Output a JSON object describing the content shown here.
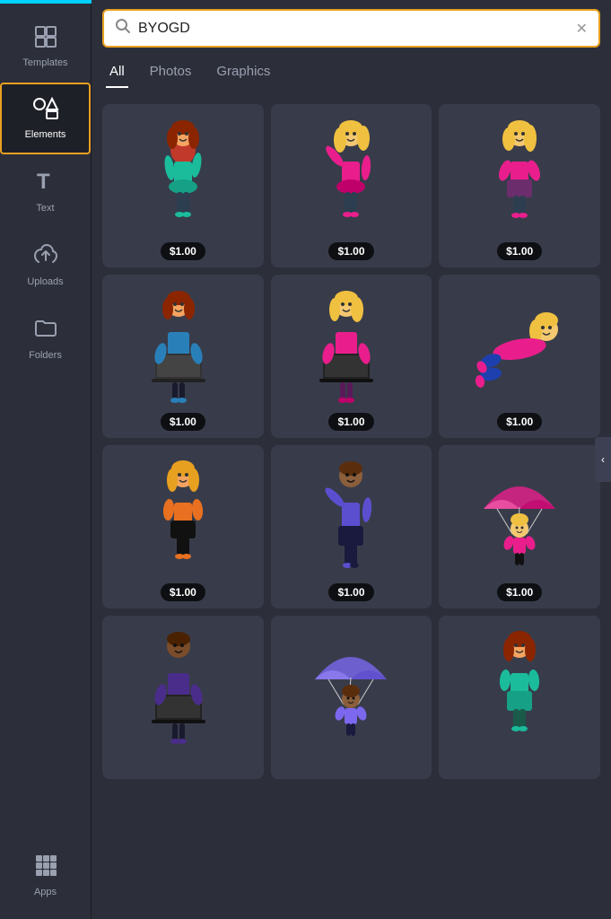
{
  "sidebar": {
    "items": [
      {
        "id": "templates",
        "label": "Templates",
        "icon": "⊞",
        "active": false
      },
      {
        "id": "elements",
        "label": "Elements",
        "icon": "◯△□",
        "active": true
      },
      {
        "id": "text",
        "label": "Text",
        "icon": "T",
        "active": false
      },
      {
        "id": "uploads",
        "label": "Uploads",
        "icon": "↑",
        "active": false
      },
      {
        "id": "folders",
        "label": "Folders",
        "icon": "🗂",
        "active": false
      },
      {
        "id": "apps",
        "label": "Apps",
        "icon": "⋯",
        "active": false
      }
    ]
  },
  "search": {
    "value": "BYOGD",
    "placeholder": "Search"
  },
  "tabs": [
    {
      "id": "all",
      "label": "All",
      "active": true
    },
    {
      "id": "photos",
      "label": "Photos",
      "active": false
    },
    {
      "id": "graphics",
      "label": "Graphics",
      "active": false
    }
  ],
  "items": [
    {
      "id": 1,
      "price": "$1.00",
      "color1": "#c0392b",
      "type": "girl-standing"
    },
    {
      "id": 2,
      "price": "$1.00",
      "color1": "#f0c040",
      "type": "girl-waving"
    },
    {
      "id": 3,
      "price": "$1.00",
      "color1": "#f0c040",
      "type": "girl-arms-crossed"
    },
    {
      "id": 4,
      "price": "$1.00",
      "color1": "#c0392b",
      "type": "girl-laptop"
    },
    {
      "id": 5,
      "price": "$1.00",
      "color1": "#f0c040",
      "type": "girl-laptop2"
    },
    {
      "id": 6,
      "price": "$1.00",
      "color1": "#f0c040",
      "type": "girl-lying"
    },
    {
      "id": 7,
      "price": "$1.00",
      "color1": "#e8a020",
      "type": "girl-orange"
    },
    {
      "id": 8,
      "price": "$1.00",
      "color1": "#2c2c5e",
      "type": "boy-waving"
    },
    {
      "id": 9,
      "price": "$1.00",
      "color1": "#f0c040",
      "type": "girl-parachute"
    },
    {
      "id": 10,
      "price": null,
      "color1": "#2c2c5e",
      "type": "boy-laptop"
    },
    {
      "id": 11,
      "price": null,
      "color1": "#7b68ee",
      "type": "boy-parachute2"
    },
    {
      "id": 12,
      "price": null,
      "color1": "#c0392b",
      "type": "girl-teal"
    }
  ],
  "collapse_icon": "‹"
}
